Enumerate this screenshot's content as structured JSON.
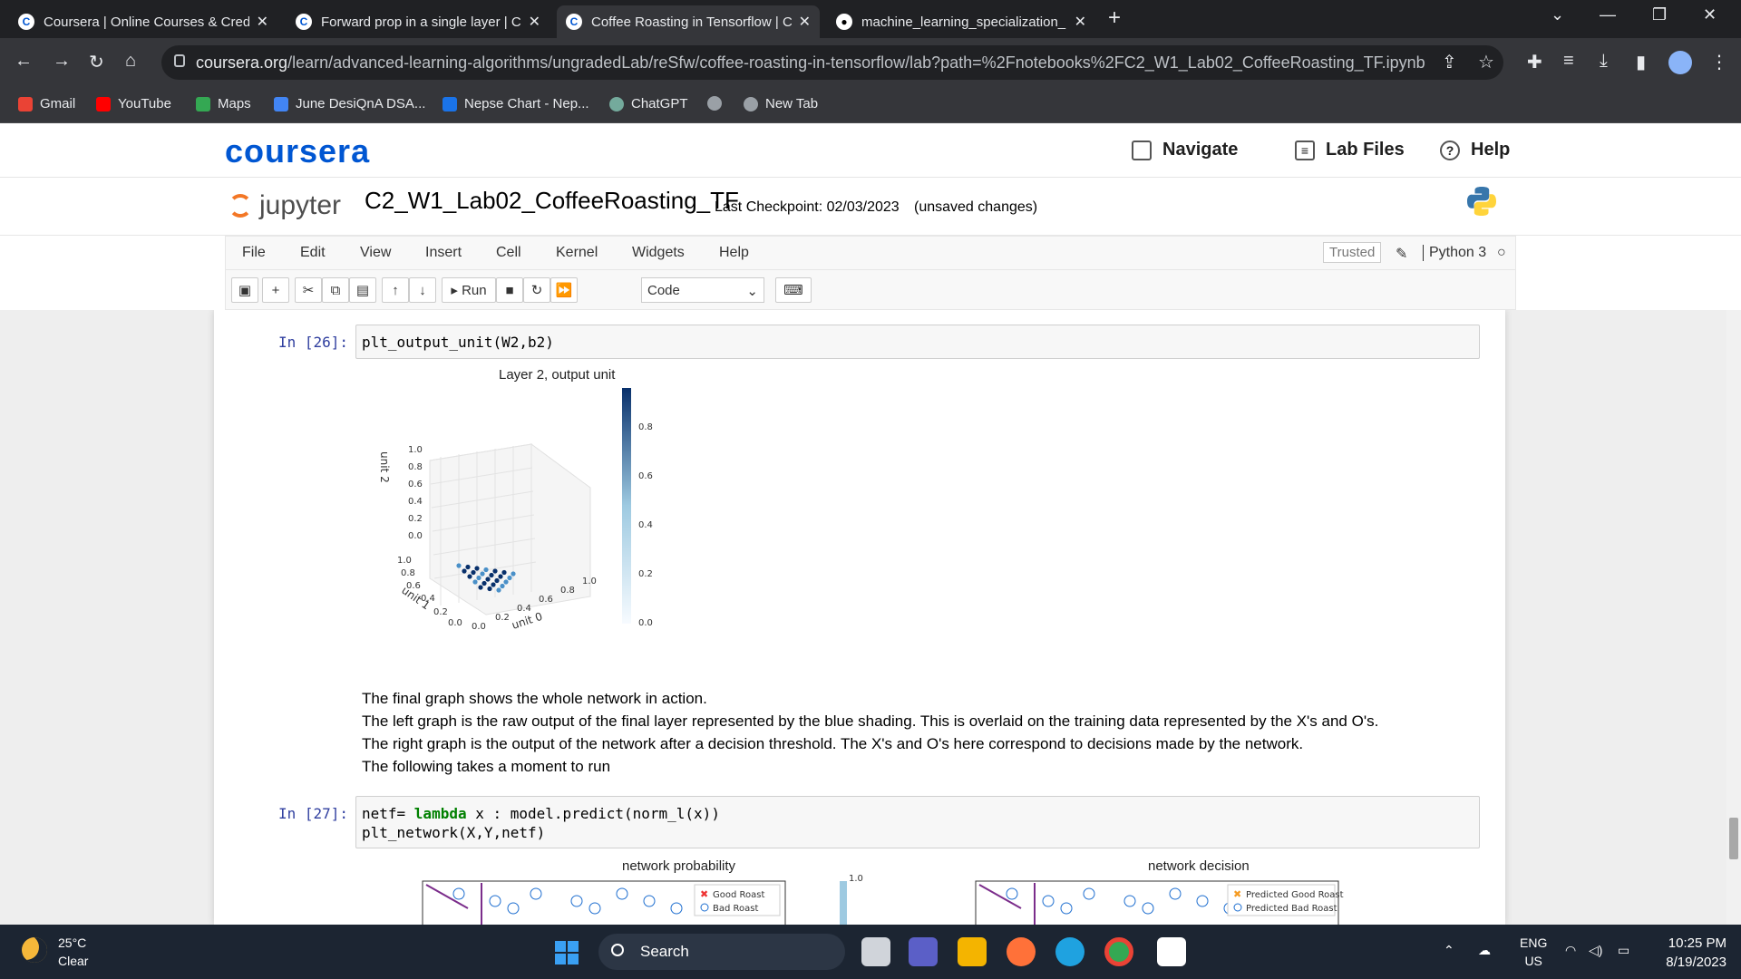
{
  "browser": {
    "tabs": [
      {
        "title": "Coursera | Online Courses & Cred",
        "favicon": "coursera-icon",
        "active": false
      },
      {
        "title": "Forward prop in a single layer | C",
        "favicon": "coursera-icon",
        "active": false
      },
      {
        "title": "Coffee Roasting in Tensorflow | C",
        "favicon": "coursera-icon",
        "active": true
      },
      {
        "title": "machine_learning_specialization_",
        "favicon": "github-icon",
        "active": false
      }
    ],
    "new_tab": "+",
    "url_host": "coursera.org",
    "url_path": "/learn/advanced-learning-algorithms/ungradedLab/reSfw/coffee-roasting-in-tensorflow/lab?path=%2Fnotebooks%2FC2_W1_Lab02_CoffeeRoasting_TF.ipynb",
    "bookmarks": [
      {
        "label": "Gmail",
        "color": "#ea4335"
      },
      {
        "label": "YouTube",
        "color": "#ff0000"
      },
      {
        "label": "Maps",
        "color": "#34a853"
      },
      {
        "label": "June DesiQnA DSA...",
        "color": "#4285f4"
      },
      {
        "label": "Nepse Chart - Nep...",
        "color": "#1a73e8"
      },
      {
        "label": "ChatGPT",
        "color": "#74aa9c"
      },
      {
        "label": "",
        "color": "#9aa0a6"
      },
      {
        "label": "New Tab",
        "color": "#9aa0a6"
      }
    ]
  },
  "coursera": {
    "logo": "coursera",
    "navigate": "Navigate",
    "lab_files": "Lab Files",
    "help": "Help"
  },
  "jupyter": {
    "logo_text": "jupyter",
    "notebook_name": "C2_W1_Lab02_CoffeeRoasting_TF",
    "checkpoint": "Last Checkpoint: 02/03/2023",
    "unsaved": "(unsaved changes)",
    "menus": [
      "File",
      "Edit",
      "View",
      "Insert",
      "Cell",
      "Kernel",
      "Widgets",
      "Help"
    ],
    "trusted": "Trusted",
    "kernel": "Python 3",
    "run_label": "Run",
    "cell_type": "Code"
  },
  "cells": {
    "cell26_prompt": "In [26]:",
    "cell26_code": "plt_output_unit(W2,b2)",
    "cell27_prompt": "In [27]:",
    "cell27_line1_a": "netf= ",
    "cell27_line1_kw": "lambda",
    "cell27_line1_b": " x : model.predict(norm_l(x))",
    "cell27_line2": "plt_network(X,Y,netf)"
  },
  "markdown": {
    "p1": "The final graph shows the whole network in action.",
    "p2": "The left graph is the raw output of the final layer represented by the blue shading. This is overlaid on the training data represented by the X's and O's.",
    "p3": "The right graph is the output of the network after a decision threshold. The X's and O's here correspond to decisions made by the network.",
    "p4": "The following takes a moment to run"
  },
  "chart_data": [
    {
      "type": "scatter",
      "title": "Layer 2, output unit",
      "xlabel": "unit 0",
      "ylabel": "unit 1",
      "zlabel": "unit 2",
      "x_ticks": [
        "0.0",
        "0.2",
        "0.4",
        "0.6",
        "0.8",
        "1.0"
      ],
      "y_ticks": [
        "0.0",
        "0.2",
        "0.4",
        "0.6",
        "0.8",
        "1.0"
      ],
      "z_ticks": [
        "0.0",
        "0.2",
        "0.4",
        "0.6",
        "0.8",
        "1.0"
      ],
      "colorbar_ticks": [
        "0.0",
        "0.2",
        "0.4",
        "0.6",
        "0.8"
      ],
      "colormap": [
        "#f7fbff",
        "#08306b"
      ]
    },
    {
      "type": "scatter",
      "title": "network probability",
      "legend": [
        "Good Roast",
        "Bad Roast"
      ],
      "colorbar_ticks": [
        "1.0"
      ]
    },
    {
      "type": "scatter",
      "title": "network decision",
      "legend": [
        "Predicted Good Roast",
        "Predicted Bad Roast"
      ]
    }
  ],
  "taskbar": {
    "temp": "25°C",
    "condition": "Clear",
    "search": "Search",
    "lang1": "ENG",
    "lang2": "US",
    "time": "10:25 PM",
    "date": "8/19/2023"
  }
}
